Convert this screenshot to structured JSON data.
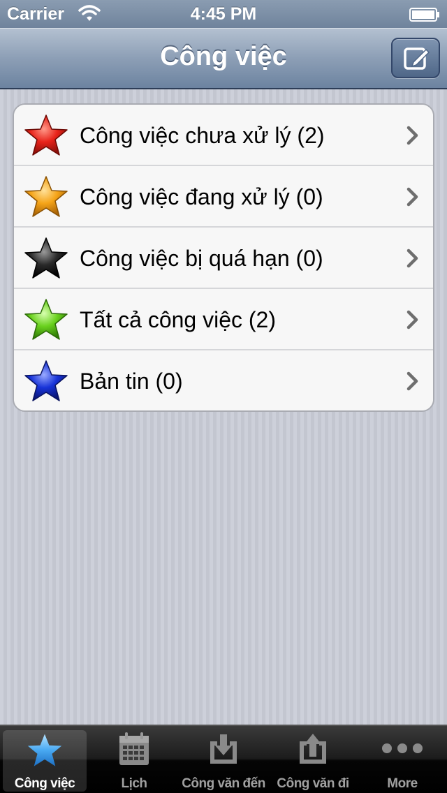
{
  "status_bar": {
    "carrier": "Carrier",
    "time": "4:45 PM",
    "wifi_icon": "wifi-icon",
    "battery_icon": "battery-icon"
  },
  "nav_bar": {
    "title": "Công việc",
    "compose_icon": "compose-icon"
  },
  "list": {
    "items": [
      {
        "label": "Công việc chưa xử lý (2)",
        "star_color": "#e8231a",
        "icon": "red-star-icon"
      },
      {
        "label": "Công việc đang xử lý (0)",
        "star_color": "#f5a418",
        "icon": "orange-star-icon"
      },
      {
        "label": "Công việc bị quá hạn (0)",
        "star_color": "#1a1a1a",
        "icon": "black-star-icon"
      },
      {
        "label": "Tất cả công việc (2)",
        "star_color": "#6ad11e",
        "icon": "green-star-icon"
      },
      {
        "label": "Bản tin (0)",
        "star_color": "#1733d8",
        "icon": "blue-star-icon"
      }
    ]
  },
  "tab_bar": {
    "tabs": [
      {
        "label": "Công việc",
        "icon": "star-icon",
        "selected": true
      },
      {
        "label": "Lịch",
        "icon": "calendar-icon",
        "selected": false
      },
      {
        "label": "Công văn đến",
        "icon": "inbox-download-icon",
        "selected": false
      },
      {
        "label": "Công văn đi",
        "icon": "outbox-upload-icon",
        "selected": false
      },
      {
        "label": "More",
        "icon": "more-dots-icon",
        "selected": false
      }
    ]
  },
  "colors": {
    "nav_bar": "#8d9fb6",
    "tab_selected_icon": "#49a9f2",
    "background": "#c9ccd6"
  }
}
